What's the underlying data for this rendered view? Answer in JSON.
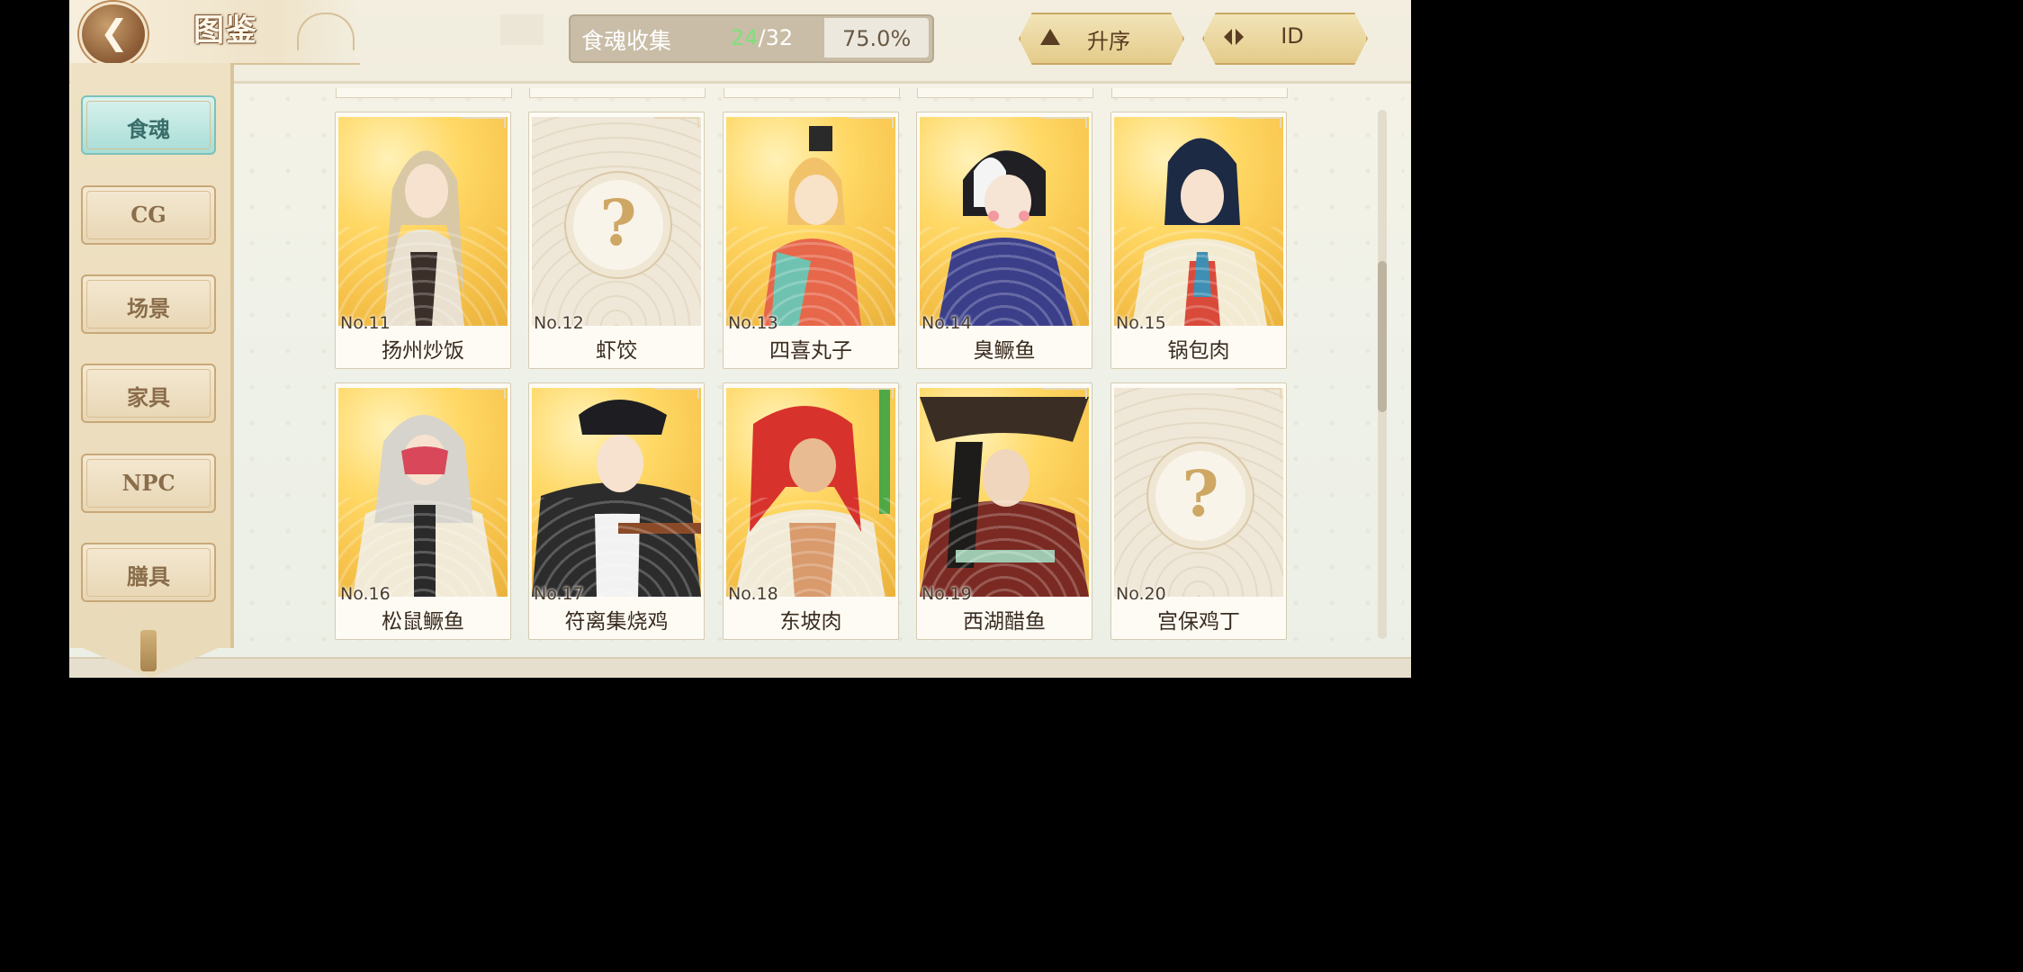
{
  "header": {
    "title": "图鉴",
    "collection_label": "食魂收集",
    "collected": "24",
    "total": "/32",
    "percent": "75.0%",
    "sort_order_label": "升序",
    "sort_key_label": "ID"
  },
  "sidebar": {
    "items": [
      {
        "label": "食魂",
        "active": true
      },
      {
        "label": "CG",
        "active": false
      },
      {
        "label": "场景",
        "active": false
      },
      {
        "label": "家具",
        "active": false
      },
      {
        "label": "NPC",
        "active": false
      },
      {
        "label": "膳具",
        "active": false
      }
    ]
  },
  "cards": [
    {
      "no": "No.11",
      "name": "扬州炒饭",
      "unlocked": true
    },
    {
      "no": "No.12",
      "name": "虾饺",
      "unlocked": false
    },
    {
      "no": "No.13",
      "name": "四喜丸子",
      "unlocked": true
    },
    {
      "no": "No.14",
      "name": "臭鳜鱼",
      "unlocked": true
    },
    {
      "no": "No.15",
      "name": "锅包肉",
      "unlocked": true
    },
    {
      "no": "No.16",
      "name": "松鼠鳜鱼",
      "unlocked": true
    },
    {
      "no": "No.17",
      "name": "符离集烧鸡",
      "unlocked": true
    },
    {
      "no": "No.18",
      "name": "东坡肉",
      "unlocked": true
    },
    {
      "no": "No.19",
      "name": "西湖醋鱼",
      "unlocked": true
    },
    {
      "no": "No.20",
      "name": "宫保鸡丁",
      "unlocked": false
    }
  ],
  "locked_symbol": "?",
  "colors": {
    "accent_green": "#7ee07a",
    "active_tab": "#a8ddd6",
    "card_gold": "#f6c24a"
  }
}
